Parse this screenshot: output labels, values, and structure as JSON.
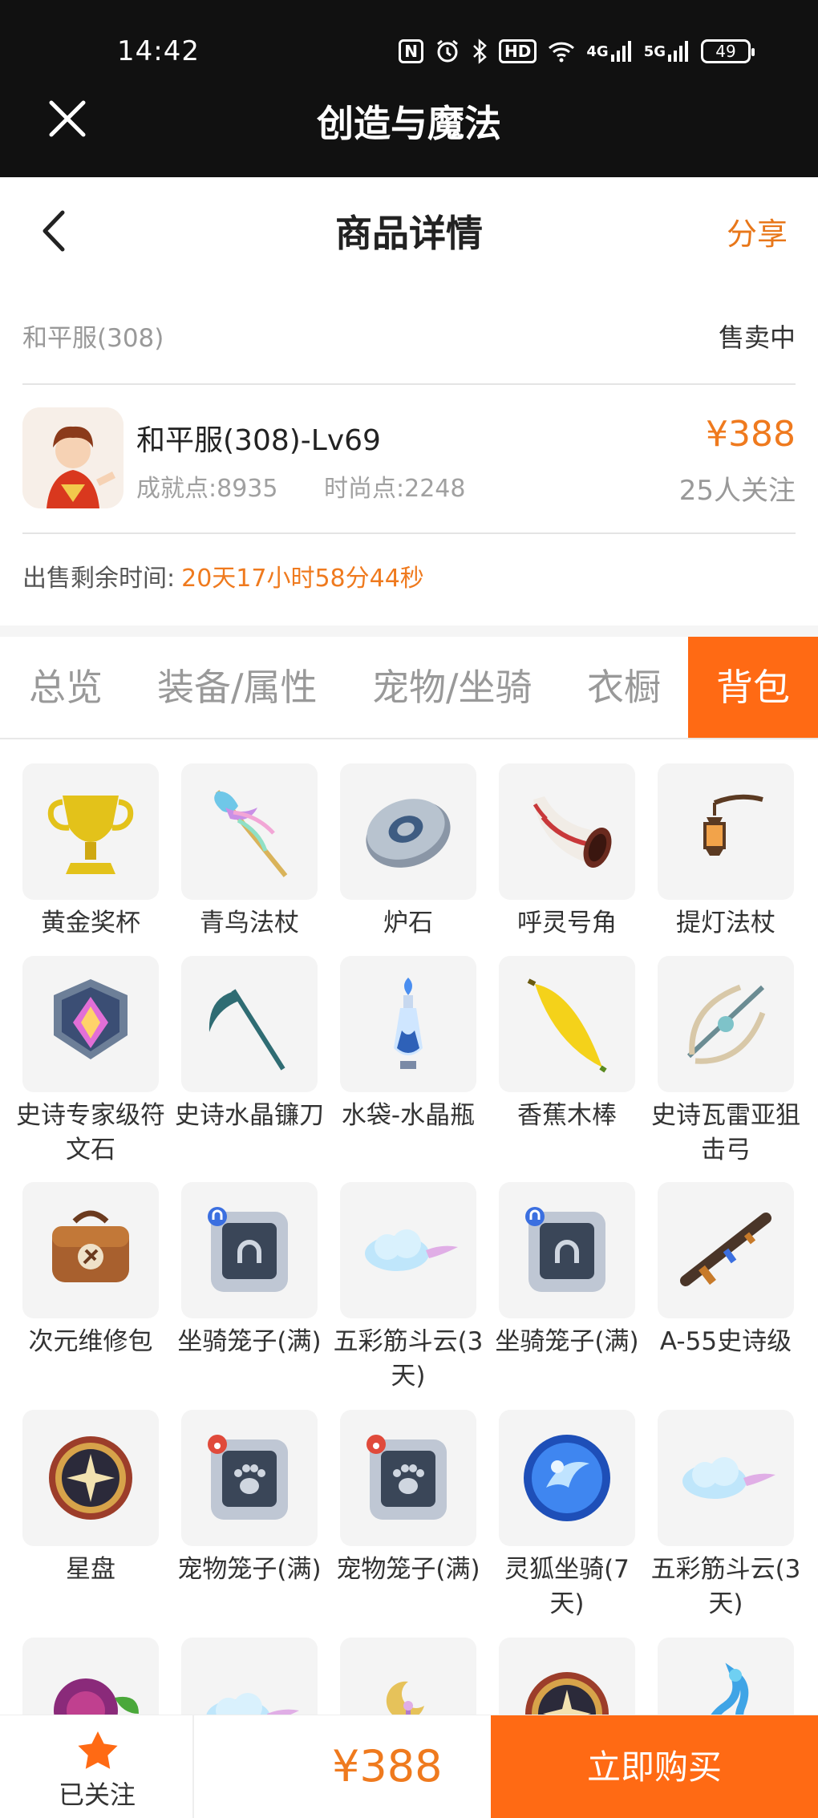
{
  "status_bar": {
    "time": "14:42",
    "icons": [
      "nfc-icon",
      "alarm-icon",
      "bluetooth-icon",
      "hd-icon",
      "wifi-icon",
      "signal-4g-icon",
      "signal-5g-icon"
    ],
    "hd_label": "HD",
    "net_4g": "4G",
    "net_5g": "5G",
    "battery": "49"
  },
  "app_bar": {
    "title": "创造与魔法"
  },
  "nav": {
    "title": "商品详情",
    "share_label": "分享"
  },
  "server": {
    "name": "和平服(308)",
    "status": "售卖中"
  },
  "product": {
    "name": "和平服(308)-Lv69",
    "achievement": "成就点:8935",
    "fashion": "时尚点:2248",
    "price": "¥388",
    "followers": "25人关注"
  },
  "remaining": {
    "label": "出售剩余时间:",
    "value": "20天17小时58分44秒"
  },
  "tabs": [
    {
      "label": "总览",
      "active": false
    },
    {
      "label": "装备/属性",
      "active": false
    },
    {
      "label": "宠物/坐骑",
      "active": false
    },
    {
      "label": "衣橱",
      "active": false
    },
    {
      "label": "背包",
      "active": true
    }
  ],
  "items": [
    {
      "label": "黄金奖杯",
      "icon": "golden-trophy-icon"
    },
    {
      "label": "青鸟法杖",
      "icon": "bluebird-staff-icon"
    },
    {
      "label": "炉石",
      "icon": "hearthstone-icon"
    },
    {
      "label": "呼灵号角",
      "icon": "horn-icon"
    },
    {
      "label": "提灯法杖",
      "icon": "lantern-staff-icon"
    },
    {
      "label": "史诗专家级符文石",
      "icon": "rune-stone-icon"
    },
    {
      "label": "史诗水晶镰刀",
      "icon": "crystal-scythe-icon"
    },
    {
      "label": "水袋-水晶瓶",
      "icon": "crystal-bottle-icon"
    },
    {
      "label": "香蕉木棒",
      "icon": "banana-club-icon"
    },
    {
      "label": "史诗瓦雷亚狙击弓",
      "icon": "sniper-bow-icon"
    },
    {
      "label": "次元维修包",
      "icon": "repair-bag-icon"
    },
    {
      "label": "坐骑笼子(满)",
      "icon": "mount-cage-icon"
    },
    {
      "label": "五彩筋斗云(3天)",
      "icon": "cloud-icon"
    },
    {
      "label": "坐骑笼子(满)",
      "icon": "mount-cage-icon"
    },
    {
      "label": "A-55史诗级",
      "icon": "rifle-icon"
    },
    {
      "label": "星盘",
      "icon": "astrolabe-icon"
    },
    {
      "label": "宠物笼子(满)",
      "icon": "pet-cage-icon"
    },
    {
      "label": "宠物笼子(满)",
      "icon": "pet-cage-icon"
    },
    {
      "label": "灵狐坐骑(7天)",
      "icon": "spirit-fox-orb-icon"
    },
    {
      "label": "五彩筋斗云(3天)",
      "icon": "cloud-icon"
    },
    {
      "label": "",
      "icon": "flower-monster-icon"
    },
    {
      "label": "",
      "icon": "cloud-icon"
    },
    {
      "label": "",
      "icon": "moon-staff-icon"
    },
    {
      "label": "",
      "icon": "astrolabe-icon"
    },
    {
      "label": "",
      "icon": "sea-dragon-icon"
    }
  ],
  "bottom_bar": {
    "follow_label": "已关注",
    "price": "¥388",
    "buy_label": "立即购买"
  },
  "colors": {
    "accent": "#ff6a14",
    "price": "#ef7a1e",
    "top_bar": "#111111"
  }
}
